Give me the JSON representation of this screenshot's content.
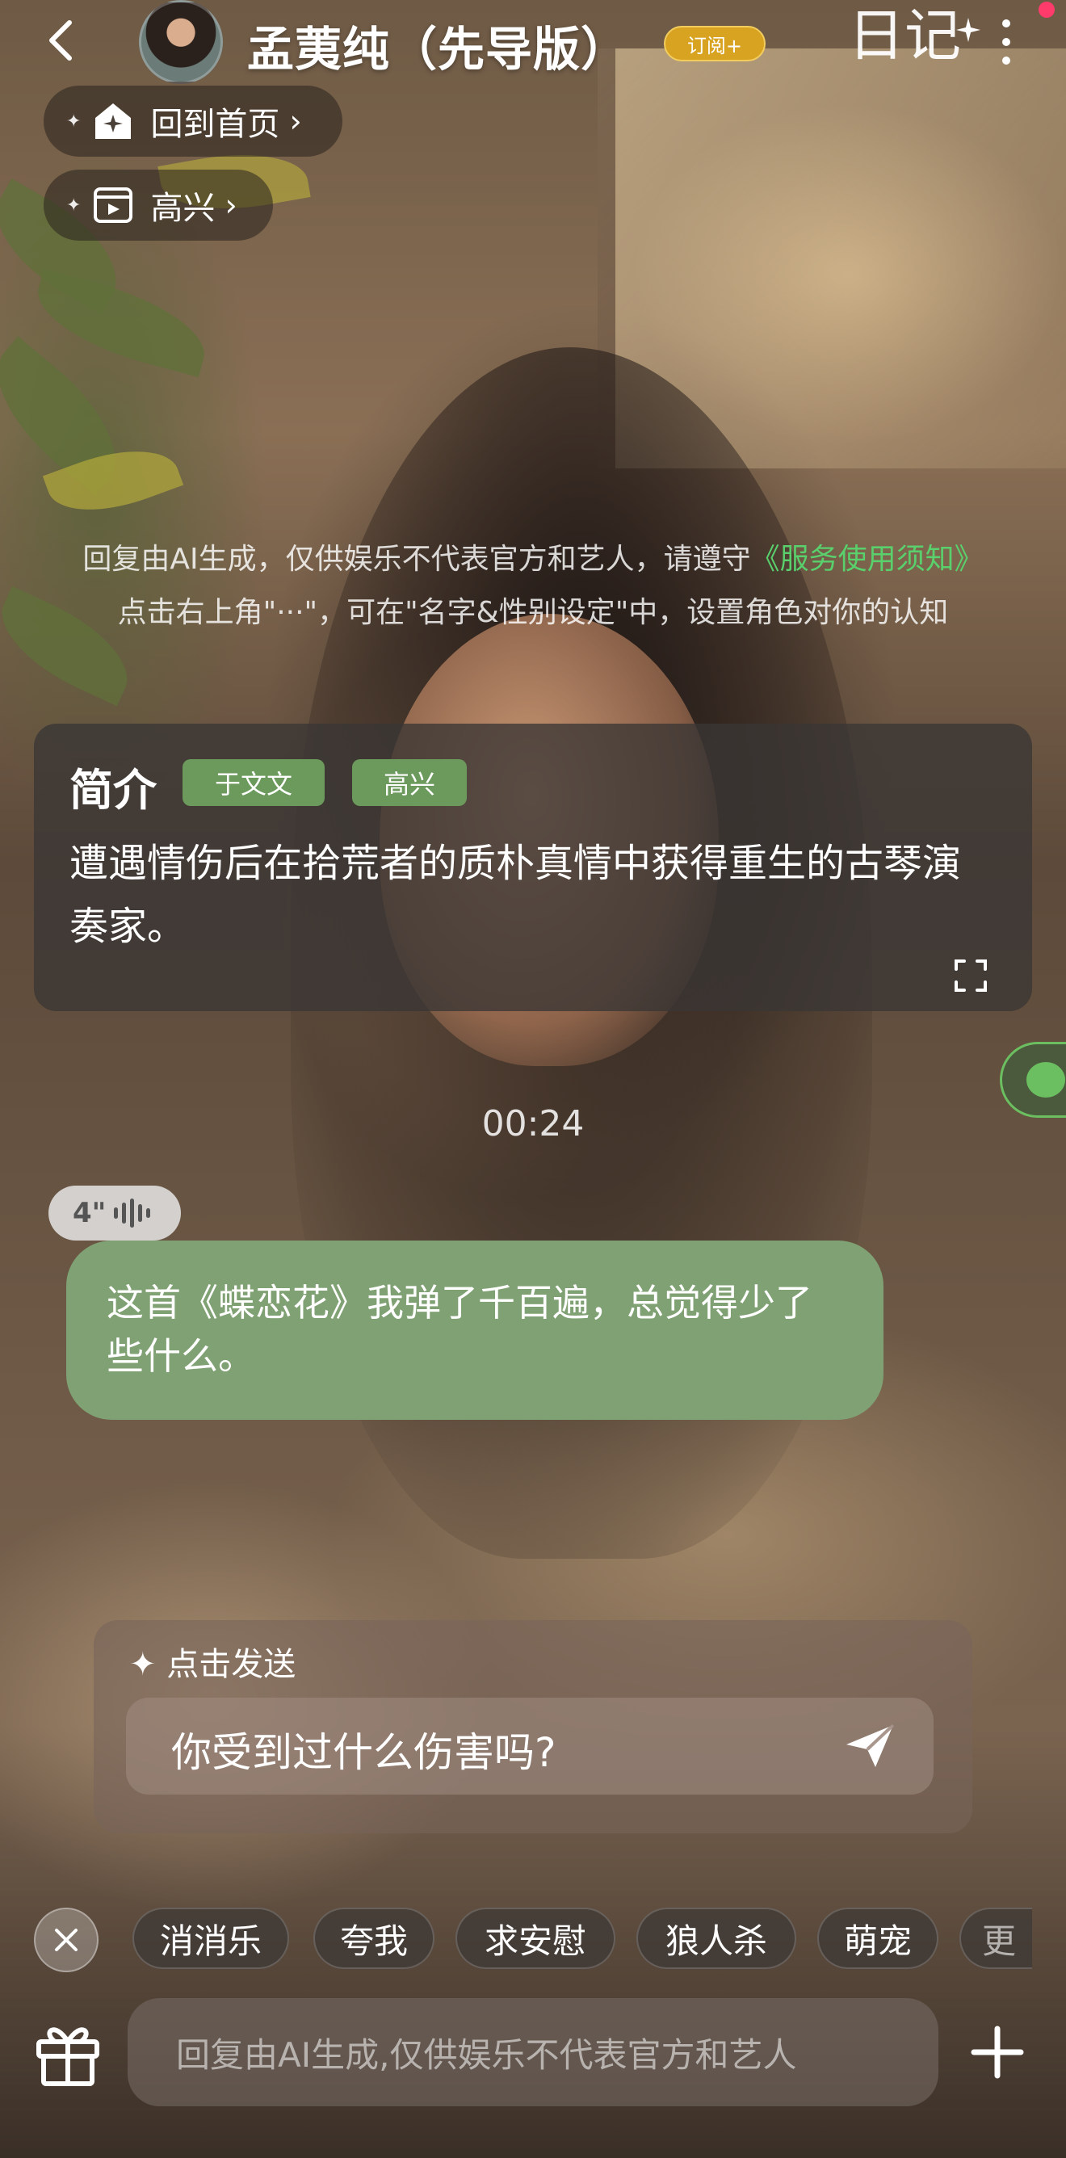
{
  "header": {
    "character_name": "孟荑纯（先导版）",
    "subscribe_label": "订阅+",
    "diary_label": "日记"
  },
  "nav_pills": {
    "home": "回到首页",
    "mood": "高兴"
  },
  "disclaimer": {
    "line1_text": "回复由AI生成，仅供娱乐不代表官方和艺人，请遵守",
    "line1_link": "《服务使用须知》",
    "line2": "点击右上角\"···\"，可在\"名字&性别设定\"中，设置角色对你的认知"
  },
  "intro": {
    "title": "简介",
    "tags": [
      "于文文",
      "高兴"
    ],
    "description": "遭遇情伤后在拾荒者的质朴真情中获得重生的古琴演奏家。"
  },
  "chat": {
    "timestamp": "00:24",
    "voice_duration": "4\"",
    "message": "这首《蝶恋花》我弹了千百遍，总觉得少了些什么。"
  },
  "suggestion": {
    "label": "点击发送",
    "text": "你受到过什么伤害吗?"
  },
  "quick_tags": [
    "消消乐",
    "夸我",
    "求安慰",
    "狼人杀",
    "萌宠",
    "更"
  ],
  "input": {
    "placeholder": "回复由AI生成,仅供娱乐不代表官方和艺人"
  },
  "colors": {
    "accent_green": "#7fa173",
    "link_green": "#59d06c",
    "badge_gold": "#d8a321",
    "notification": "#ff3b6b"
  },
  "icons": [
    "back-arrow-icon",
    "home-star-icon",
    "screen-icon",
    "chevron-right-icon",
    "more-dots-icon",
    "expand-icon",
    "chat-bubble-icon",
    "voice-wave-icon",
    "send-icon",
    "close-icon",
    "gift-icon",
    "plus-icon"
  ]
}
